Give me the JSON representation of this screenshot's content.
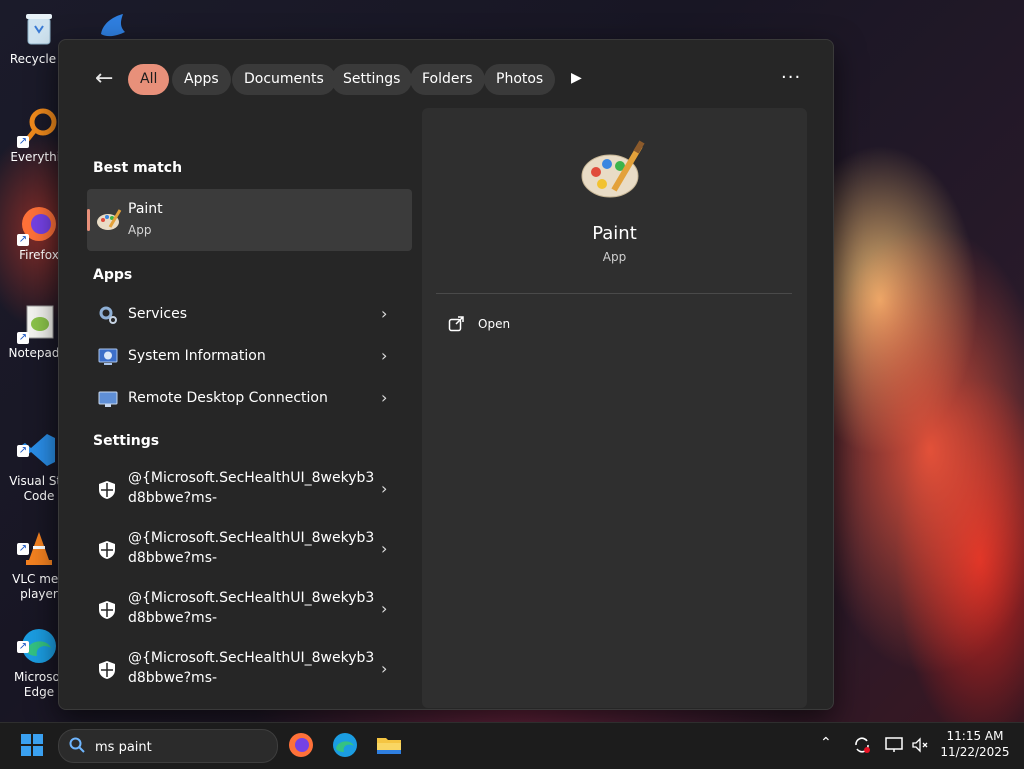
{
  "desktop": {
    "icons": [
      {
        "label": "Recycle B"
      },
      {
        "label": "Everythin"
      },
      {
        "label": "Firefox"
      },
      {
        "label": "Notepad+"
      },
      {
        "label": "Visual Stu\nCode"
      },
      {
        "label": "VLC med\nplayer"
      },
      {
        "label": "Microsof\nEdge"
      }
    ]
  },
  "search_panel": {
    "filters": [
      {
        "label": "All",
        "active": true
      },
      {
        "label": "Apps"
      },
      {
        "label": "Documents"
      },
      {
        "label": "Settings"
      },
      {
        "label": "Folders"
      },
      {
        "label": "Photos"
      }
    ],
    "best_match": {
      "title": "Best match",
      "name": "Paint",
      "kind": "App"
    },
    "apps": {
      "title": "Apps",
      "items": [
        {
          "label": "Services"
        },
        {
          "label": "System Information"
        },
        {
          "label": "Remote Desktop Connection"
        }
      ]
    },
    "settings": {
      "title": "Settings",
      "items": [
        {
          "label": "@{Microsoft.SecHealthUI_8wekyb3\nd8bbwe?ms-"
        },
        {
          "label": "@{Microsoft.SecHealthUI_8wekyb3\nd8bbwe?ms-"
        },
        {
          "label": "@{Microsoft.SecHealthUI_8wekyb3\nd8bbwe?ms-"
        },
        {
          "label": "@{Microsoft.SecHealthUI_8wekyb3\nd8bbwe?ms-"
        }
      ]
    },
    "detail": {
      "name": "Paint",
      "kind": "App",
      "actions": [
        {
          "label": "Open"
        }
      ]
    }
  },
  "taskbar": {
    "search_value": "ms paint",
    "clock": {
      "time": "11:15 AM",
      "date": "11/22/2025"
    }
  },
  "colors": {
    "accent": "#e8907a",
    "panel": "#262626",
    "detail": "#2f2f2f"
  }
}
